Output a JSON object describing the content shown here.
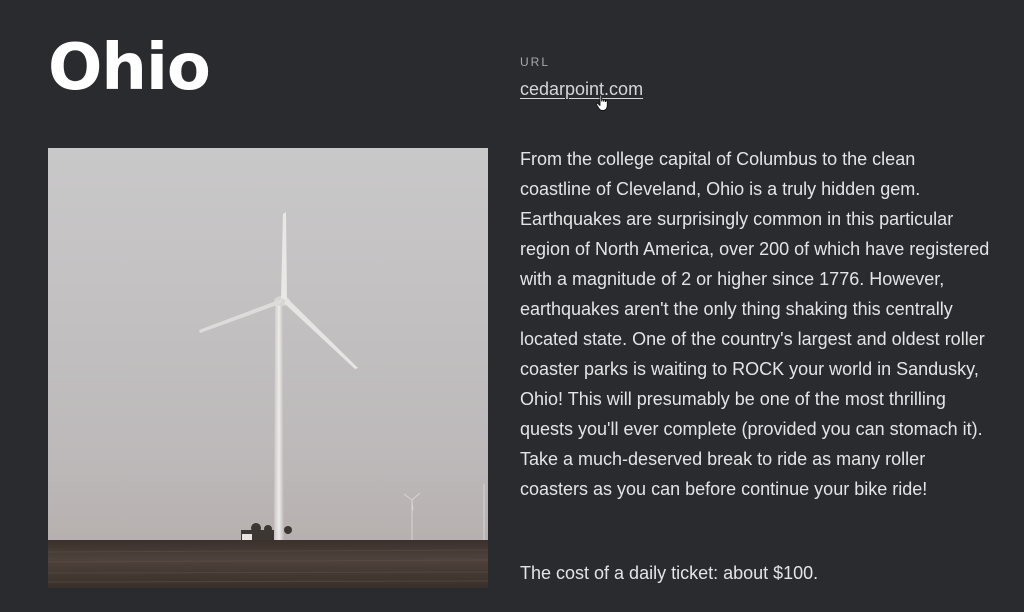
{
  "header": {
    "title": "Ohio"
  },
  "url_block": {
    "label": "URL",
    "link_text": "cedarpoint.com"
  },
  "image": {
    "subject": "wind turbine in a flat field under an overcast sky",
    "icon": "photo"
  },
  "content": {
    "description": "From the college capital of Columbus to the clean coastline of Cleveland, Ohio is a truly hidden gem. Earthquakes are surprisingly common in this particular region of North America, over 200 of which have registered with a magnitude of 2 or higher since 1776. However, earthquakes aren't the only thing shaking this centrally located state. One of the country's largest and oldest roller coaster parks is waiting to ROCK your world in Sandusky, Ohio! This will presumably be one of the most thrilling quests you'll ever complete (provided you can stomach it). Take a much-deserved break to ride as many roller coasters as you can before continue your bike ride!",
    "cost": "The cost of a daily ticket: about $100."
  },
  "colors": {
    "background": "#2a2b2f",
    "title": "#ffffff",
    "text": "#e4e4e6",
    "muted": "#a8a9ad"
  }
}
